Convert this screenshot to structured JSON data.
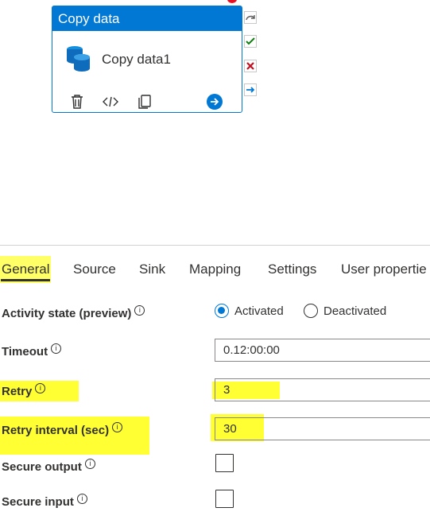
{
  "activity": {
    "header": "Copy data",
    "name": "Copy data1"
  },
  "tabs": [
    "General",
    "Source",
    "Sink",
    "Mapping",
    "Settings",
    "User propertie"
  ],
  "form": {
    "activity_state": {
      "label": "Activity state (preview)",
      "options": [
        "Activated",
        "Deactivated"
      ],
      "selected": "Activated"
    },
    "timeout": {
      "label": "Timeout",
      "value": "0.12:00:00"
    },
    "retry": {
      "label": "Retry",
      "value": "3"
    },
    "retry_interval": {
      "label": "Retry interval (sec)",
      "value": "30"
    },
    "secure_output": {
      "label": "Secure output",
      "checked": false
    },
    "secure_input": {
      "label": "Secure input",
      "checked": false
    }
  },
  "info_glyph": "i",
  "colors": {
    "accent": "#0078d4",
    "highlight": "#ffff33",
    "success": "#107c10",
    "failure": "#c50f1f"
  },
  "icons": [
    "database-icon",
    "delete-icon",
    "code-icon",
    "copy-icon",
    "arrow-right-circle-icon",
    "skip-arrow-icon",
    "success-check-icon",
    "failure-x-icon",
    "completion-arrow-icon"
  ]
}
